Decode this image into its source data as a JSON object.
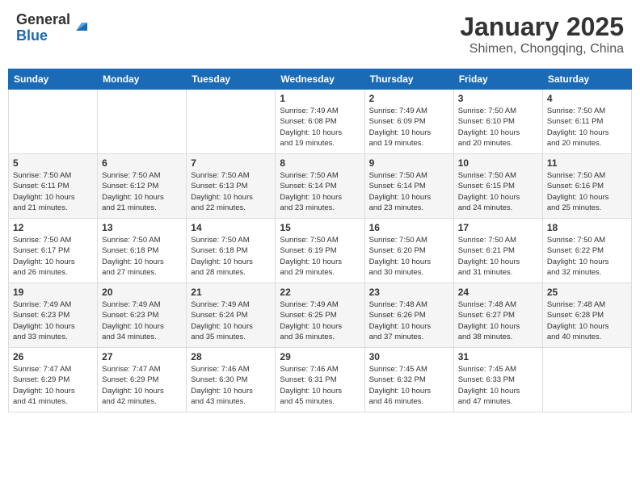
{
  "header": {
    "logo_general": "General",
    "logo_blue": "Blue",
    "month_title": "January 2025",
    "location": "Shimen, Chongqing, China"
  },
  "weekdays": [
    "Sunday",
    "Monday",
    "Tuesday",
    "Wednesday",
    "Thursday",
    "Friday",
    "Saturday"
  ],
  "weeks": [
    [
      {
        "day": "",
        "info": ""
      },
      {
        "day": "",
        "info": ""
      },
      {
        "day": "",
        "info": ""
      },
      {
        "day": "1",
        "info": "Sunrise: 7:49 AM\nSunset: 6:08 PM\nDaylight: 10 hours\nand 19 minutes."
      },
      {
        "day": "2",
        "info": "Sunrise: 7:49 AM\nSunset: 6:09 PM\nDaylight: 10 hours\nand 19 minutes."
      },
      {
        "day": "3",
        "info": "Sunrise: 7:50 AM\nSunset: 6:10 PM\nDaylight: 10 hours\nand 20 minutes."
      },
      {
        "day": "4",
        "info": "Sunrise: 7:50 AM\nSunset: 6:11 PM\nDaylight: 10 hours\nand 20 minutes."
      }
    ],
    [
      {
        "day": "5",
        "info": "Sunrise: 7:50 AM\nSunset: 6:11 PM\nDaylight: 10 hours\nand 21 minutes."
      },
      {
        "day": "6",
        "info": "Sunrise: 7:50 AM\nSunset: 6:12 PM\nDaylight: 10 hours\nand 21 minutes."
      },
      {
        "day": "7",
        "info": "Sunrise: 7:50 AM\nSunset: 6:13 PM\nDaylight: 10 hours\nand 22 minutes."
      },
      {
        "day": "8",
        "info": "Sunrise: 7:50 AM\nSunset: 6:14 PM\nDaylight: 10 hours\nand 23 minutes."
      },
      {
        "day": "9",
        "info": "Sunrise: 7:50 AM\nSunset: 6:14 PM\nDaylight: 10 hours\nand 23 minutes."
      },
      {
        "day": "10",
        "info": "Sunrise: 7:50 AM\nSunset: 6:15 PM\nDaylight: 10 hours\nand 24 minutes."
      },
      {
        "day": "11",
        "info": "Sunrise: 7:50 AM\nSunset: 6:16 PM\nDaylight: 10 hours\nand 25 minutes."
      }
    ],
    [
      {
        "day": "12",
        "info": "Sunrise: 7:50 AM\nSunset: 6:17 PM\nDaylight: 10 hours\nand 26 minutes."
      },
      {
        "day": "13",
        "info": "Sunrise: 7:50 AM\nSunset: 6:18 PM\nDaylight: 10 hours\nand 27 minutes."
      },
      {
        "day": "14",
        "info": "Sunrise: 7:50 AM\nSunset: 6:18 PM\nDaylight: 10 hours\nand 28 minutes."
      },
      {
        "day": "15",
        "info": "Sunrise: 7:50 AM\nSunset: 6:19 PM\nDaylight: 10 hours\nand 29 minutes."
      },
      {
        "day": "16",
        "info": "Sunrise: 7:50 AM\nSunset: 6:20 PM\nDaylight: 10 hours\nand 30 minutes."
      },
      {
        "day": "17",
        "info": "Sunrise: 7:50 AM\nSunset: 6:21 PM\nDaylight: 10 hours\nand 31 minutes."
      },
      {
        "day": "18",
        "info": "Sunrise: 7:50 AM\nSunset: 6:22 PM\nDaylight: 10 hours\nand 32 minutes."
      }
    ],
    [
      {
        "day": "19",
        "info": "Sunrise: 7:49 AM\nSunset: 6:23 PM\nDaylight: 10 hours\nand 33 minutes."
      },
      {
        "day": "20",
        "info": "Sunrise: 7:49 AM\nSunset: 6:23 PM\nDaylight: 10 hours\nand 34 minutes."
      },
      {
        "day": "21",
        "info": "Sunrise: 7:49 AM\nSunset: 6:24 PM\nDaylight: 10 hours\nand 35 minutes."
      },
      {
        "day": "22",
        "info": "Sunrise: 7:49 AM\nSunset: 6:25 PM\nDaylight: 10 hours\nand 36 minutes."
      },
      {
        "day": "23",
        "info": "Sunrise: 7:48 AM\nSunset: 6:26 PM\nDaylight: 10 hours\nand 37 minutes."
      },
      {
        "day": "24",
        "info": "Sunrise: 7:48 AM\nSunset: 6:27 PM\nDaylight: 10 hours\nand 38 minutes."
      },
      {
        "day": "25",
        "info": "Sunrise: 7:48 AM\nSunset: 6:28 PM\nDaylight: 10 hours\nand 40 minutes."
      }
    ],
    [
      {
        "day": "26",
        "info": "Sunrise: 7:47 AM\nSunset: 6:29 PM\nDaylight: 10 hours\nand 41 minutes."
      },
      {
        "day": "27",
        "info": "Sunrise: 7:47 AM\nSunset: 6:29 PM\nDaylight: 10 hours\nand 42 minutes."
      },
      {
        "day": "28",
        "info": "Sunrise: 7:46 AM\nSunset: 6:30 PM\nDaylight: 10 hours\nand 43 minutes."
      },
      {
        "day": "29",
        "info": "Sunrise: 7:46 AM\nSunset: 6:31 PM\nDaylight: 10 hours\nand 45 minutes."
      },
      {
        "day": "30",
        "info": "Sunrise: 7:45 AM\nSunset: 6:32 PM\nDaylight: 10 hours\nand 46 minutes."
      },
      {
        "day": "31",
        "info": "Sunrise: 7:45 AM\nSunset: 6:33 PM\nDaylight: 10 hours\nand 47 minutes."
      },
      {
        "day": "",
        "info": ""
      }
    ]
  ]
}
